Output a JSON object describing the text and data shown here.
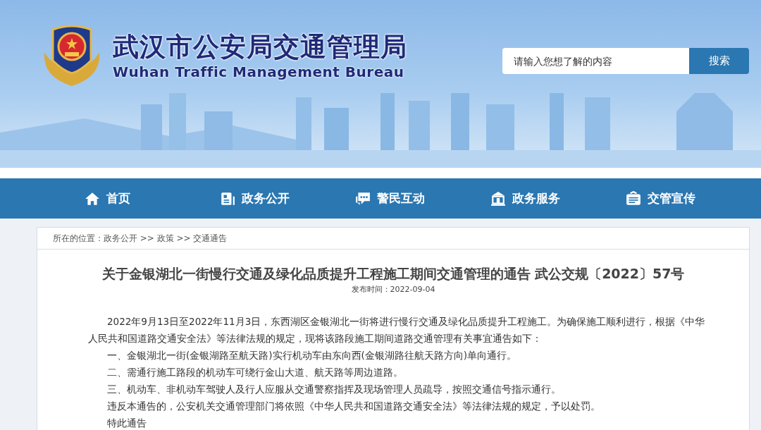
{
  "header": {
    "title": "武汉市公安局交通管理局",
    "subtitle": "Wuhan Traffic Management Bureau"
  },
  "search": {
    "placeholder": "请输入您想了解的内容",
    "button": "搜索"
  },
  "nav": [
    {
      "label": "首页"
    },
    {
      "label": "政务公开"
    },
    {
      "label": "警民互动"
    },
    {
      "label": "政务服务"
    },
    {
      "label": "交管宣传"
    }
  ],
  "breadcrumb": "所在的位置：政务公开 >> 政策 >> 交通通告",
  "article": {
    "title": "关于金银湖北一街慢行交通及绿化品质提升工程施工期间交通管理的通告 武公交规〔2022〕57号",
    "date": "发布时间：2022-09-04",
    "paragraphs": [
      "2022年9月13日至2022年11月3日，东西湖区金银湖北一街将进行慢行交通及绿化品质提升工程施工。为确保施工顺利进行，根据《中华人民共和国道路交通安全法》等法律法规的规定，现将该路段施工期间道路交通管理有关事宜通告如下：",
      "一、金银湖北一街(金银湖路至航天路)实行机动车由东向西(金银湖路往航天路方向)单向通行。",
      "二、需通行施工路段的机动车可绕行金山大道、航天路等周边道路。",
      "三、机动车、非机动车驾驶人及行人应服从交通警察指挥及现场管理人员疏导，按照交通信号指示通行。",
      "违反本通告的，公安机关交通管理部门将依照《中华人民共和国道路交通安全法》等法律法规的规定，予以处罚。",
      "特此通告"
    ]
  }
}
